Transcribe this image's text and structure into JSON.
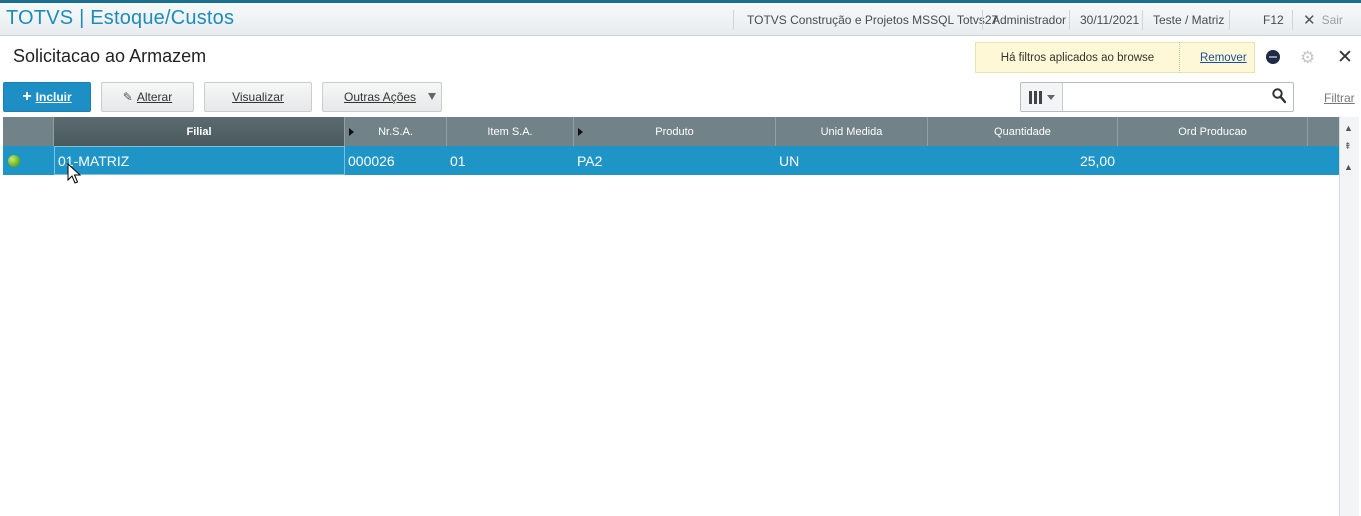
{
  "topbar": {
    "app_title": "TOTVS | Estoque/Custos",
    "environment": "TOTVS Construção e Projetos MSSQL Totvs27",
    "user": "Administrador",
    "date": "30/11/2021",
    "company": "Teste / Matriz",
    "shortcut": "F12",
    "exit_label": "Sair"
  },
  "header": {
    "page_title": "Solicitacao ao Armazem",
    "filter_notice": "Há filtros aplicados ao browse",
    "remove_label": "Remover"
  },
  "toolbar": {
    "incluir_label": "Incluir",
    "alterar_label": "Alterar",
    "visualizar_label": "Visualizar",
    "outras_acoes_label": "Outras Ações",
    "search_value": "",
    "filtrar_label": "Filtrar"
  },
  "grid": {
    "columns": [
      "Filial",
      "Nr.S.A.",
      "Item S.A.",
      "Produto",
      "Unid Medida",
      "Quantidade",
      "Ord Producao"
    ],
    "rows": [
      {
        "filial": "01-MATRIZ",
        "nr_sa": "000026",
        "item_sa": "01",
        "produto": "PA2",
        "unid_medida": "UN",
        "quantidade": "25,00",
        "ord_producao": ""
      }
    ]
  },
  "colors": {
    "accent": "#1d8fc4",
    "header_bar": "#718389",
    "selected_row": "#1f95c7",
    "status_legend": "#6fb31f"
  }
}
